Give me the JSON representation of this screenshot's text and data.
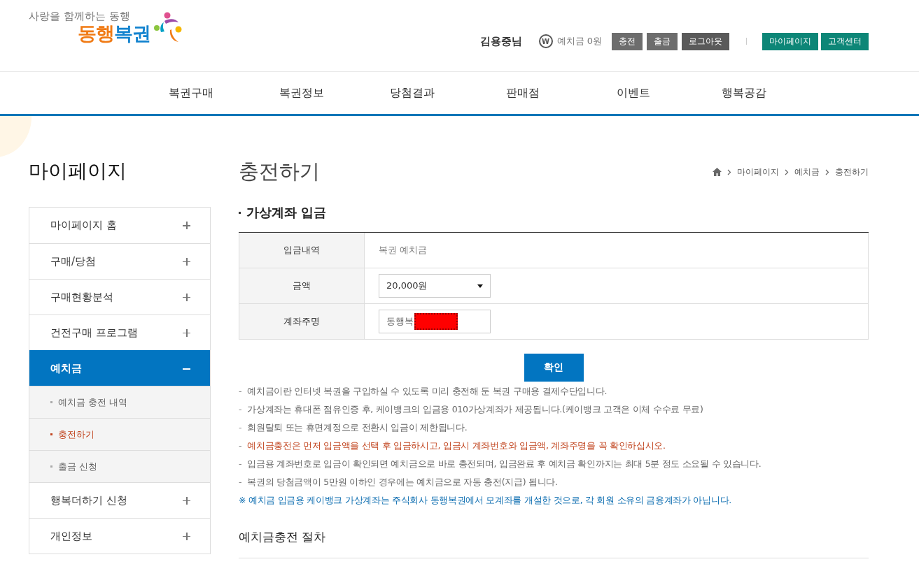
{
  "logo": {
    "tagline": "사랑을 함께하는 동행",
    "words": [
      {
        "text": "동행",
        "color": "#f07a14"
      },
      {
        "text": "복권",
        "color": "#1383cf"
      }
    ]
  },
  "user": {
    "name": "김용중님",
    "balance": "예치금 0원",
    "balance_icon": "W"
  },
  "account_buttons": [
    {
      "label": "충전",
      "kind": "gray"
    },
    {
      "label": "출금",
      "kind": "gray"
    },
    {
      "label": "로그아웃",
      "kind": "dark"
    },
    {
      "label": "마이페이지",
      "kind": "teal"
    },
    {
      "label": "고객센터",
      "kind": "teal"
    }
  ],
  "nav": [
    "복권구매",
    "복권정보",
    "당첨결과",
    "판매점",
    "이벤트",
    "행복공감"
  ],
  "sidebar": {
    "title": "마이페이지",
    "items": [
      {
        "label": "마이페이지 홈",
        "selected": false,
        "expanded": false
      },
      {
        "label": "구매/당첨",
        "selected": false,
        "expanded": false
      },
      {
        "label": "구매현황분석",
        "selected": false,
        "expanded": false
      },
      {
        "label": "건전구매 프로그램",
        "selected": false,
        "expanded": false
      },
      {
        "label": "예치금",
        "selected": true,
        "expanded": true,
        "children": [
          {
            "label": "예치금 충전 내역",
            "selected": false
          },
          {
            "label": "충전하기",
            "selected": true
          },
          {
            "label": "출금 신청",
            "selected": false
          }
        ]
      },
      {
        "label": "행복더하기 신청",
        "selected": false,
        "expanded": false
      },
      {
        "label": "개인정보",
        "selected": false,
        "expanded": false
      }
    ]
  },
  "page_title": "충전하기",
  "breadcrumb": [
    "마이페이지",
    "예치금",
    "충전하기"
  ],
  "section_title": "가상계좌 입금",
  "form": [
    {
      "label": "입금내역",
      "kind": "text",
      "value": "복권 예치금"
    },
    {
      "label": "금액",
      "kind": "select",
      "value": "20,000원"
    },
    {
      "label": "계좌주명",
      "kind": "input",
      "value": "동행복",
      "redacted": true
    }
  ],
  "confirm_button": "확인",
  "notes": [
    {
      "marker": "-",
      "text": "예치금이란 인터넷 복권을 구입하실 수 있도록 미리 충전해 둔 복권 구매용 결제수단입니다.",
      "kind": "normal"
    },
    {
      "marker": "-",
      "text": "가상계좌는 휴대폰 점유인증 후, 케이뱅크의 입금용 010가상계좌가 제공됩니다.(케이뱅크 고객은 이체 수수료 무료)",
      "kind": "normal"
    },
    {
      "marker": "-",
      "text": "회원탈퇴 또는 휴면계정으로 전환시 입금이 제한됩니다.",
      "kind": "normal"
    },
    {
      "marker": "-",
      "text": "예치금충전은 먼저 입금액을 선택 후 입금하시고, 입금시 계좌번호와 입금액, 계좌주명을 꼭 확인하십시오.",
      "kind": "warning"
    },
    {
      "marker": "-",
      "text": "입금용 계좌번호로 입금이 확인되면 예치금으로 바로 충전되며, 입금완료 후 예치금 확인까지는 최대 5분 정도 소요될 수 있습니다.",
      "kind": "normal"
    },
    {
      "marker": "-",
      "text": "복권의 당첨금액이 5만원 이하인 경우에는 예치금으로 자동 충전(지급) 됩니다.",
      "kind": "normal"
    },
    {
      "text": "※ 예치금 입금용 케이뱅크 가상계좌는 주식회사 동행복권에서 모계좌를 개설한 것으로, 각 회원 소유의 금융계좌가 아닙니다.",
      "kind": "notice"
    }
  ],
  "procedure_title": "예치금충전 절차"
}
